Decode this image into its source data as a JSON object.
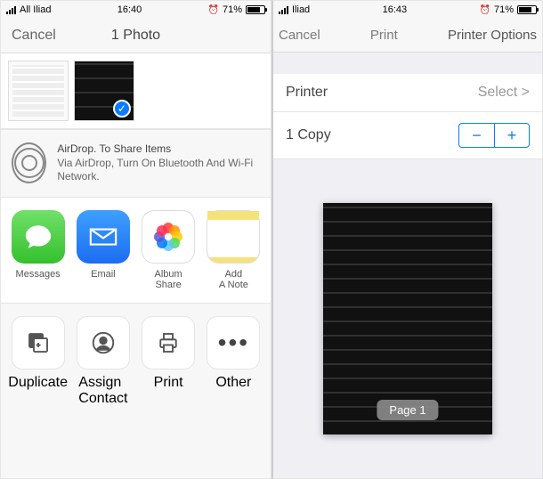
{
  "left": {
    "status": {
      "carrier": "All Iliad",
      "time": "16:40",
      "battery": "71%"
    },
    "nav": {
      "cancel": "Cancel",
      "title": "1 Photo"
    },
    "airdrop": {
      "title": "AirDrop. To Share Items",
      "subtitle": "Via AirDrop, Turn On Bluetooth And Wi-Fi Network."
    },
    "apps": {
      "messages": "Messages",
      "email": "Email",
      "album_share": "Album\nShare",
      "add_note": "Add\nA Note"
    },
    "actions": {
      "duplicate": "Duplicate",
      "assign_contact": "Assign\nContact",
      "print": "Print",
      "other": "Other"
    }
  },
  "right": {
    "status": {
      "carrier": "Iliad",
      "time": "16:43",
      "battery": "71%"
    },
    "nav": {
      "cancel": "Cancel",
      "print": "Print",
      "title": "Printer Options"
    },
    "printer_row": {
      "label": "Printer",
      "value": "Select >"
    },
    "copies_row": {
      "label": "1 Copy",
      "minus": "−",
      "plus": "+"
    },
    "preview": {
      "page_label": "Page 1"
    }
  }
}
